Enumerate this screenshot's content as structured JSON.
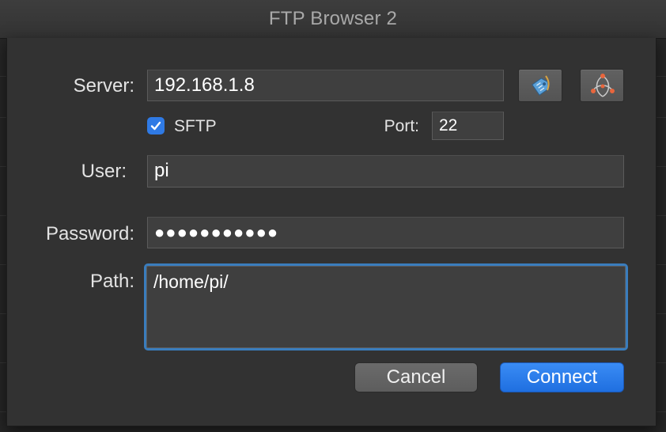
{
  "window": {
    "title": "FTP Browser 2"
  },
  "form": {
    "server_label": "Server:",
    "server_value": "192.168.1.8",
    "sftp_label": "SFTP",
    "sftp_checked": true,
    "port_label": "Port:",
    "port_value": "22",
    "user_label": "User:",
    "user_value": "pi",
    "password_label": "Password:",
    "password_value": "●●●●●●●●●●●",
    "path_label": "Path:",
    "path_value": "/home/pi/"
  },
  "buttons": {
    "cancel": "Cancel",
    "connect": "Connect"
  },
  "icons": {
    "bookmark": "bookmark-tag-icon",
    "network": "bonjour-network-icon"
  },
  "colors": {
    "accent": "#2f7ae5",
    "focus_ring": "#3a7dbd",
    "connect": "#1f6fe0"
  }
}
